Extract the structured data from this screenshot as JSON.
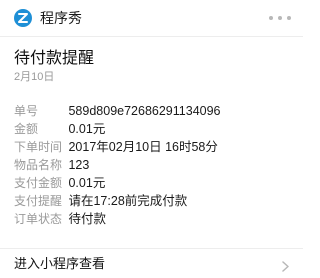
{
  "header": {
    "app_name": "程序秀",
    "icon": "app-logo-icon",
    "more_icon": "more-dots-icon"
  },
  "message": {
    "title": "待付款提醒",
    "date": "2月10日"
  },
  "details": [
    {
      "label": "单号",
      "value": "589d809e72686291134096"
    },
    {
      "label": "金额",
      "value": "0.01元"
    },
    {
      "label": "下单时间",
      "value": "2017年02月10日 16时58分"
    },
    {
      "label": "物品名称",
      "value": "123"
    },
    {
      "label": "支付金额",
      "value": "0.01元"
    },
    {
      "label": "支付提醒",
      "value": "请在17:28前完成付款"
    },
    {
      "label": "订单状态",
      "value": "待付款"
    }
  ],
  "footer": {
    "label": "进入小程序查看",
    "icon": "chevron-right-icon"
  },
  "colors": {
    "accent": "#1e8fd6",
    "label": "#9a9a9a",
    "text": "#1a1a1a"
  }
}
